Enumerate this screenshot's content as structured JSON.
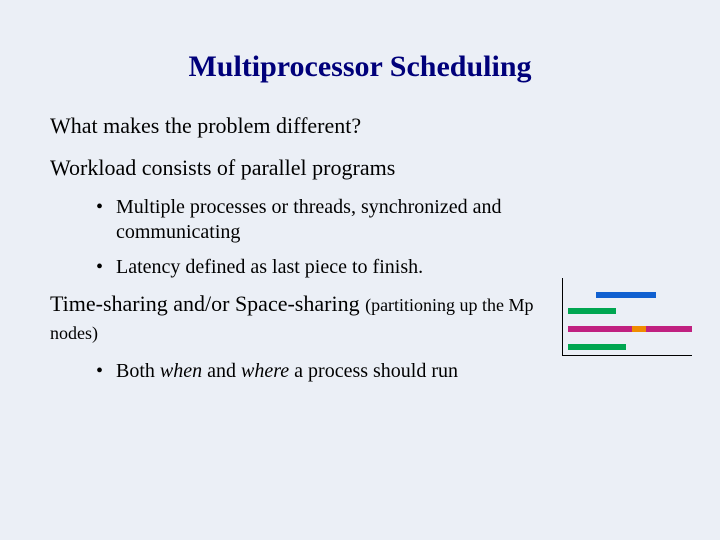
{
  "title": "Multiprocessor Scheduling",
  "body": {
    "p1": "What makes the problem different?",
    "p2": "Workload consists of parallel programs",
    "p2_b1": "Multiple processes or threads, synchronized and communicating",
    "p2_b2": "Latency defined as last piece to finish.",
    "p3_a": "Time-sharing and/or Space-sharing ",
    "p3_b": "(partitioning up the Mp nodes)",
    "p3_b1_a": "Both ",
    "p3_b1_b": "when",
    "p3_b1_c": " and ",
    "p3_b1_d": "where",
    "p3_b1_e": " a process should run"
  },
  "chart_data": {
    "type": "bar",
    "title": "",
    "xlabel": "",
    "ylabel": "",
    "xlim": [
      0,
      130
    ],
    "rows": [
      {
        "y": 6,
        "segments": [
          {
            "x": 6,
            "w": 58,
            "color": "#00a651"
          }
        ]
      },
      {
        "y": 24,
        "segments": [
          {
            "x": 6,
            "w": 64,
            "color": "#c02080"
          },
          {
            "x": 70,
            "w": 14,
            "color": "#f08c00"
          },
          {
            "x": 84,
            "w": 46,
            "color": "#c02080"
          }
        ]
      },
      {
        "y": 42,
        "segments": [
          {
            "x": 6,
            "w": 48,
            "color": "#00a651"
          }
        ]
      },
      {
        "y": 58,
        "segments": [
          {
            "x": 34,
            "w": 60,
            "color": "#1060d0"
          }
        ]
      }
    ]
  },
  "colors": {
    "title": "#00007a",
    "bg": "#ebeff6"
  }
}
